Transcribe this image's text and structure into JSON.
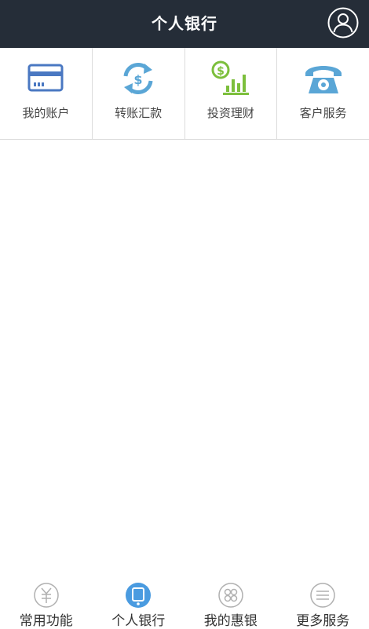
{
  "header": {
    "title": "个人银行",
    "profile_icon": "user-profile-icon"
  },
  "grid": {
    "items": [
      {
        "label": "我的账户",
        "icon": "bank-card-icon",
        "color": "#4a78c2"
      },
      {
        "label": "转账汇款",
        "icon": "transfer-icon",
        "color": "#5aa6d6"
      },
      {
        "label": "投资理财",
        "icon": "investment-chart-icon",
        "color": "#7cbf3c"
      },
      {
        "label": "客户服务",
        "icon": "telephone-icon",
        "color": "#5aa6d6"
      }
    ]
  },
  "tabbar": {
    "items": [
      {
        "label": "常用功能",
        "icon": "yen-circle-icon",
        "active": false
      },
      {
        "label": "个人银行",
        "icon": "tablet-icon",
        "active": true
      },
      {
        "label": "我的惠银",
        "icon": "grid-circle-icon",
        "active": false
      },
      {
        "label": "更多服务",
        "icon": "menu-lines-icon",
        "active": false
      }
    ],
    "active_color": "#4a9be0",
    "inactive_color": "#b0b0b0"
  }
}
